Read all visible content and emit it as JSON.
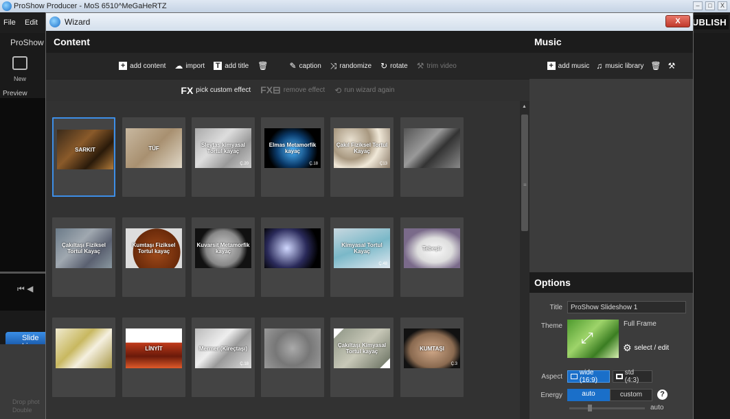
{
  "app": {
    "title": "ProShow Producer - MoS 6510^MeGaHeRTZ",
    "menu": [
      "File",
      "Edit"
    ],
    "publish_label": "PUBLISH",
    "proshow_label": "ProShow",
    "new_label": "New",
    "preview_label": "Preview",
    "slide_tab_label": "Slide Li",
    "drop_text": "Drop phot\nDouble",
    "window_buttons": [
      "–",
      "□",
      "X"
    ]
  },
  "wizard": {
    "title": "Wizard",
    "close_label": "X",
    "content": {
      "title": "Content",
      "toolbar1": [
        {
          "label": "add content",
          "icon": "plus-icon",
          "enabled": true
        },
        {
          "label": "import",
          "icon": "cloud-icon",
          "enabled": true
        },
        {
          "label": "add title",
          "icon": "title-icon",
          "enabled": true
        },
        {
          "label": "",
          "icon": "trash-icon",
          "enabled": true
        },
        {
          "label": "caption",
          "icon": "pen-icon",
          "enabled": true
        },
        {
          "label": "randomize",
          "icon": "shuffle-icon",
          "enabled": true
        },
        {
          "label": "rotate",
          "icon": "rotate-icon",
          "enabled": true
        },
        {
          "label": "trim video",
          "icon": "tools-icon",
          "enabled": false
        }
      ],
      "toolbar2": [
        {
          "label": "pick custom effect",
          "icon": "fx-icon",
          "enabled": true
        },
        {
          "label": "remove effect",
          "icon": "fx-remove-icon",
          "enabled": false
        },
        {
          "label": "run wizard again",
          "icon": "rerun-icon",
          "enabled": false
        }
      ],
      "slides": [
        {
          "text": "SARKIT",
          "sub": "",
          "bg": "linear-gradient(135deg,#3a2a1a,#8a5a2a 40%,#2a1a0a 70%,#b07a3a)",
          "selected": true
        },
        {
          "text": "TÜF",
          "sub": "",
          "bg": "linear-gradient(135deg,#c8b8a0,#a89070 50%,#e0d8c8)",
          "selected": false
        },
        {
          "text": "Sleytaş kimyasal Tortul kayaç",
          "sub": "Ç.20",
          "bg": "linear-gradient(135deg,#aaa,#ddd 40%,#999 70%,#ccc)",
          "selected": false
        },
        {
          "text": "Elmas Metamorfik kayaç",
          "sub": "Ç.18",
          "bg": "radial-gradient(circle at 50% 55%,#4fb8ff,#0a3a6a 45%,#000 70%)",
          "selected": false
        },
        {
          "text": "Çakıl Fiziksel Tortul Kayaç",
          "sub": "Ç13",
          "bg": "radial-gradient(circle at 30% 30%,#e8e0d0,#a89880 40%,#f0e8d8 60%,#8a7a68)",
          "selected": false
        },
        {
          "text": "",
          "sub": "",
          "bg": "linear-gradient(135deg,#555,#999 40%,#333 60%,#888)",
          "selected": false
        },
        {
          "text": "Çakıltaşı Fiziksel Tortul Kayaç",
          "sub": "",
          "bg": "linear-gradient(135deg,#6a7a88,#a0a8b0 40%,#5a6070 70%,#8a98a0)",
          "selected": false
        },
        {
          "text": "Kumtaşı Fiziksel Tortul kayaç",
          "sub": "",
          "bg": "radial-gradient(circle at 55% 60%,#a04a1a,#6a2a0a 60%,#ddd 61%)",
          "selected": false
        },
        {
          "text": "Kuvarsit Metamorfik kayaç",
          "sub": "",
          "bg": "radial-gradient(circle at 50% 50%,#ccc,#888 50%,#111 70%)",
          "selected": false
        },
        {
          "text": "",
          "sub": "",
          "bg": "radial-gradient(circle at 40% 50%,#d0d8ff,#2a2a5a 50%,#000 80%)",
          "selected": false
        },
        {
          "text": "Kimyasal Tortul Kayaç",
          "sub": "Ç.48",
          "bg": "linear-gradient(160deg,#c8d8e0,#7ab8c8 50%,#e0e8f0)",
          "selected": false
        },
        {
          "text": "Tebeşir",
          "sub": "",
          "bg": "radial-gradient(ellipse at 55% 55%,#fafafa,#ddd 40%,#7a6a8a 70%)",
          "selected": false
        },
        {
          "text": "",
          "sub": "",
          "bg": "linear-gradient(135deg,#f0ead0,#c8b860 40%,#f5f0e0 60%,#a89848)",
          "selected": false
        },
        {
          "text": "LİNYİT",
          "sub": "",
          "bg": "linear-gradient(#fff 0%,#fff 35%,#c03a1a 36%,#6a1a0a 70%,#e05a2a)",
          "selected": false
        },
        {
          "text": "Mermer (Kireçtaşı)",
          "sub": "Ç.18",
          "bg": "linear-gradient(135deg,#bbb,#eee 40%,#999 60%,#ddd)",
          "selected": false
        },
        {
          "text": "",
          "sub": "",
          "bg": "radial-gradient(circle,#aaa,#777 50%,#999)",
          "selected": false
        },
        {
          "text": "Çakıltaşı Kimyasal Tortul kayaç",
          "sub": "",
          "bg": "linear-gradient(135deg,#fff 10%,#9aa090 11%,#c8c8b8 50%,#7a8070 89%,#fff 90%)",
          "selected": false
        },
        {
          "text": "KUMTAŞI",
          "sub": "Ç.3",
          "bg": "radial-gradient(ellipse at 50% 55%,#d0a888,#8a6a50 55%,#111 75%)",
          "selected": false
        }
      ]
    },
    "music": {
      "title": "Music",
      "toolbar": [
        {
          "label": "add music",
          "icon": "plus-icon",
          "enabled": true
        },
        {
          "label": "music library",
          "icon": "music-note-icon",
          "enabled": true
        },
        {
          "label": "",
          "icon": "trash-icon",
          "enabled": true
        },
        {
          "label": "",
          "icon": "tools-icon",
          "enabled": true
        }
      ]
    },
    "options": {
      "title": "Options",
      "title_label": "Title",
      "title_value": "ProShow Slideshow 1",
      "theme_label": "Theme",
      "theme_name": "Full Frame",
      "theme_edit": "select / edit",
      "aspect_label": "Aspect",
      "aspect_wide": "wide (16:9)",
      "aspect_std": "std (4:3)",
      "energy_label": "Energy",
      "energy_auto": "auto",
      "energy_custom": "custom",
      "energy_slider_label": "auto",
      "help": "?"
    }
  },
  "colors": {
    "accent": "#1a6fc9",
    "selected_border": "#3d8fe8",
    "close_red": "#c0392b"
  }
}
